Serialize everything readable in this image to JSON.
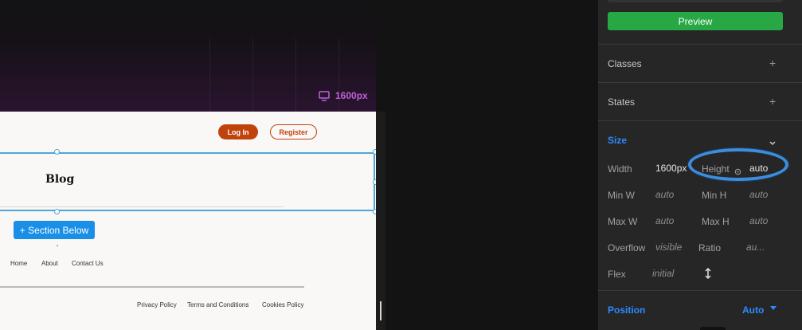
{
  "canvas": {
    "breakpoint": {
      "icon": "monitor-icon",
      "label": "1600px",
      "color": "#c060d8"
    }
  },
  "site": {
    "header": {
      "login_label": "Log In",
      "register_label": "Register",
      "accent": "#c0430c"
    },
    "blog_title": "Blog",
    "section_below_label": "+ Section Below",
    "nav": [
      "Home",
      "About",
      "Contact Us"
    ],
    "footer_links": [
      "Privacy Policy",
      "Terms and Conditions",
      "Cookies Policy"
    ]
  },
  "panel": {
    "preview_label": "Preview",
    "sections": {
      "classes": "Classes",
      "states": "States",
      "size": "Size",
      "position": "Position"
    },
    "plus_icon": "+",
    "size": {
      "width_label": "Width",
      "width_value": "1600px",
      "height_label": "Height",
      "height_value": "auto",
      "min_w_label": "Min W",
      "min_w_value": "auto",
      "min_h_label": "Min H",
      "min_h_value": "auto",
      "max_w_label": "Max W",
      "max_w_value": "auto",
      "max_h_label": "Max H",
      "max_h_value": "auto",
      "overflow_label": "Overflow",
      "overflow_value": "visible",
      "ratio_label": "Ratio",
      "ratio_value": "au...",
      "flex_label": "Flex",
      "flex_value": "initial"
    },
    "position_value": "Auto",
    "colors": {
      "preview": "#27a844",
      "active": "#2a8cff",
      "highlight_ring": "#3c8ddf"
    }
  }
}
